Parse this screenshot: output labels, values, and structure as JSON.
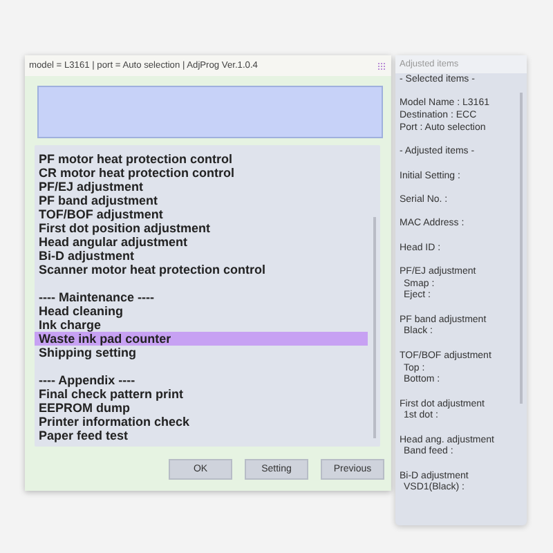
{
  "window": {
    "title": "model = L3161 | port = Auto selection | AdjProg Ver.1.0.4"
  },
  "menu": {
    "sections": [
      {
        "items": [
          {
            "label": "PF motor heat protection control",
            "selected": false
          },
          {
            "label": "CR motor heat protection control",
            "selected": false
          },
          {
            "label": "PF/EJ adjustment",
            "selected": false
          },
          {
            "label": "PF band adjustment",
            "selected": false
          },
          {
            "label": "TOF/BOF adjustment",
            "selected": false
          },
          {
            "label": "First dot position adjustment",
            "selected": false
          },
          {
            "label": "Head angular adjustment",
            "selected": false
          },
          {
            "label": "Bi-D adjustment",
            "selected": false
          },
          {
            "label": "Scanner motor heat protection control",
            "selected": false
          }
        ]
      },
      {
        "heading": "---- Maintenance ----",
        "items": [
          {
            "label": "Head cleaning",
            "selected": false
          },
          {
            "label": "Ink charge",
            "selected": false
          },
          {
            "label": "Waste ink pad counter",
            "selected": true
          },
          {
            "label": "Shipping setting",
            "selected": false
          }
        ]
      },
      {
        "heading": "---- Appendix ----",
        "items": [
          {
            "label": "Final check pattern print",
            "selected": false
          },
          {
            "label": "EEPROM dump",
            "selected": false
          },
          {
            "label": "Printer information check",
            "selected": false
          },
          {
            "label": "Paper feed test",
            "selected": false
          }
        ]
      }
    ]
  },
  "buttons": [
    "OK",
    "Setting",
    "Previous"
  ],
  "side_panel": {
    "title": "Adjusted items",
    "groups": [
      [
        {
          "label": "- Selected items -"
        }
      ],
      [
        {
          "label": "Model Name : L3161"
        },
        {
          "label": "Destination : ECC"
        },
        {
          "label": "Port : Auto selection"
        }
      ],
      [
        {
          "label": "- Adjusted items -"
        }
      ],
      [
        {
          "label": "Initial Setting :"
        }
      ],
      [
        {
          "label": "Serial No. :"
        }
      ],
      [
        {
          "label": "MAC Address :"
        }
      ],
      [
        {
          "label": "Head ID :"
        }
      ],
      [
        {
          "label": "PF/EJ adjustment",
          "children": [
            {
              "label": "Smap :"
            },
            {
              "label": "Eject :"
            }
          ]
        }
      ],
      [
        {
          "label": "PF band adjustment",
          "children": [
            {
              "label": "Black :"
            }
          ]
        }
      ],
      [
        {
          "label": "TOF/BOF adjustment",
          "children": [
            {
              "label": "Top :"
            },
            {
              "label": "Bottom :"
            }
          ]
        }
      ],
      [
        {
          "label": "First dot adjustment",
          "children": [
            {
              "label": "1st dot :"
            }
          ]
        }
      ],
      [
        {
          "label": "Head ang. adjustment",
          "children": [
            {
              "label": "Band feed :"
            }
          ]
        }
      ],
      [
        {
          "label": "Bi-D adjustment",
          "children": [
            {
              "label": "VSD1(Black) :"
            }
          ]
        }
      ]
    ]
  }
}
